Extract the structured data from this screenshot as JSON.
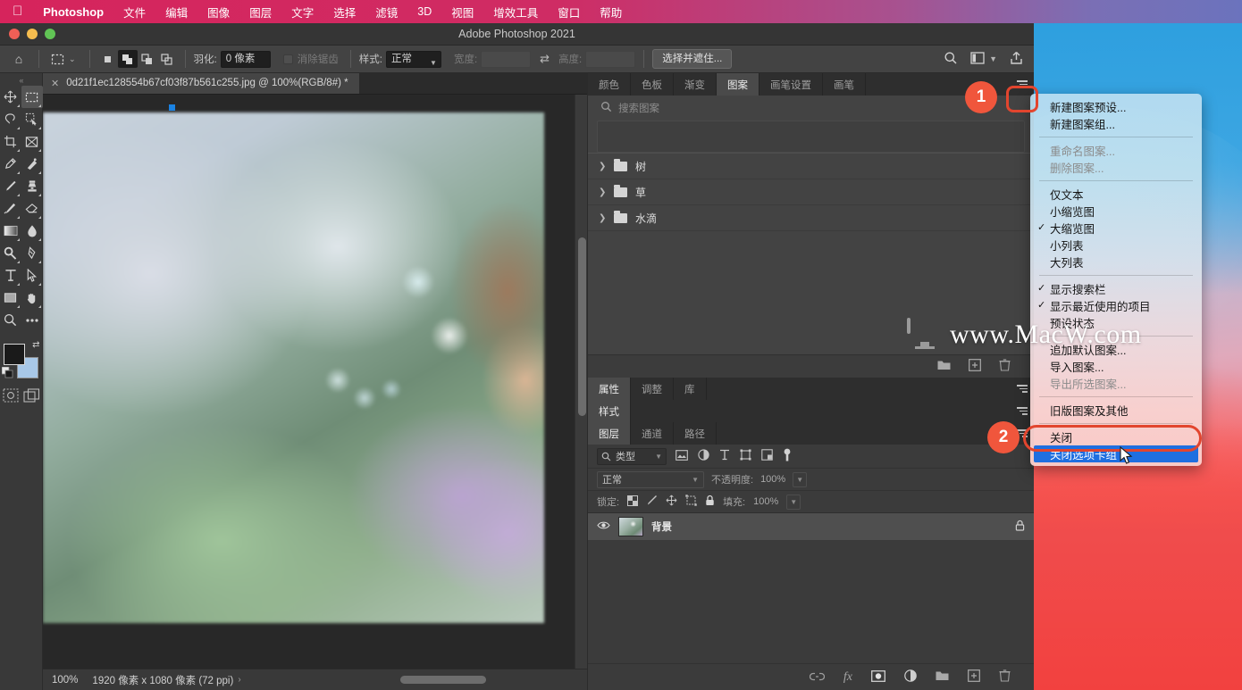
{
  "menubar": {
    "apple_icon": "apple-logo-icon",
    "app_name": "Photoshop",
    "items": [
      "文件",
      "编辑",
      "图像",
      "图层",
      "文字",
      "选择",
      "滤镜",
      "3D",
      "视图",
      "增效工具",
      "窗口",
      "帮助"
    ]
  },
  "window": {
    "title": "Adobe Photoshop 2021"
  },
  "options_bar": {
    "home_icon": "home-icon",
    "tool_icon": "marquee-tool-icon",
    "chevron": "⌄",
    "selection_modes": [
      "new-selection-icon",
      "add-to-selection-icon",
      "subtract-from-selection-icon",
      "intersect-selection-icon"
    ],
    "feather_label": "羽化:",
    "feather_value": "0 像素",
    "antialias_label": "消除锯齿",
    "style_label": "样式:",
    "style_value": "正常",
    "width_label": "宽度:",
    "width_value": "",
    "swap_icon": "swap-arrows-icon",
    "height_label": "高度:",
    "height_value": "",
    "select_mask_button": "选择并遮住...",
    "search_icon": "search-icon",
    "workspace_icon": "workspace-icon",
    "share_icon": "share-icon"
  },
  "document": {
    "tab_close_icon": "close-icon",
    "tab_title": "0d21f1ec128554b67cf03f87b561c255.jpg @ 100%(RGB/8#) *"
  },
  "status_bar": {
    "zoom": "100%",
    "dimensions": "1920 像素 x 1080 像素 (72 ppi)",
    "chevron": "›"
  },
  "toolbox": {
    "grip_icon": "panel-grip-icon",
    "tools": [
      "move-tool-icon",
      "rectangular-marquee-tool-icon",
      "lasso-tool-icon",
      "quick-selection-tool-icon",
      "crop-tool-icon",
      "frame-tool-icon",
      "eyedropper-tool-icon",
      "healing-brush-tool-icon",
      "brush-tool-icon",
      "clone-stamp-tool-icon",
      "history-brush-tool-icon",
      "eraser-tool-icon",
      "gradient-tool-icon",
      "blur-tool-icon",
      "dodge-tool-icon",
      "pen-tool-icon",
      "type-tool-icon",
      "path-selection-tool-icon",
      "rectangle-tool-icon",
      "hand-tool-icon",
      "zoom-tool-icon",
      "more-tools-icon"
    ],
    "foreground_color": "#1a1a1a",
    "background_color": "#a8c8e8",
    "swap_colors_icon": "swap-colors-icon",
    "default_colors_icon": "default-colors-icon",
    "quick_mask_icon": "quick-mask-icon",
    "screen_mode_icon": "screen-mode-icon"
  },
  "panels": {
    "patterns_group": {
      "tabs": [
        "颜色",
        "色板",
        "渐变",
        "图案",
        "画笔设置",
        "画笔"
      ],
      "active_tab": "图案",
      "menu_icon": "panel-menu-icon",
      "search_icon": "search-icon",
      "search_placeholder": "搜索图案",
      "groups": [
        "树",
        "草",
        "水滴"
      ],
      "footer_icons": [
        "new-group-icon",
        "new-pattern-icon",
        "delete-icon"
      ]
    },
    "properties_group": {
      "tabs": [
        "属性",
        "调整",
        "库"
      ],
      "active_tab": "属性",
      "menu_icon": "panel-menu-icon"
    },
    "styles_group": {
      "tabs": [
        "样式"
      ],
      "active_tab": "样式",
      "menu_icon": "panel-menu-icon"
    },
    "layers_group": {
      "tabs": [
        "图层",
        "通道",
        "路径"
      ],
      "active_tab": "图层",
      "menu_icon": "panel-menu-icon"
    }
  },
  "layers": {
    "filter_label": "类型",
    "filter_search_icon": "search-icon",
    "filter_icons": [
      "pixel-filter-icon",
      "adjustment-filter-icon",
      "type-filter-icon",
      "shape-filter-icon",
      "smartobject-filter-icon",
      "filter-toggle-icon"
    ],
    "blend_mode": "正常",
    "opacity_label": "不透明度:",
    "opacity_value": "100%",
    "lock_label": "锁定:",
    "lock_icons": [
      "lock-transparent-icon",
      "lock-image-icon",
      "lock-position-icon",
      "lock-artboard-icon",
      "lock-all-icon"
    ],
    "fill_label": "填充:",
    "fill_value": "100%",
    "rows": [
      {
        "visibility_icon": "eye-icon",
        "name": "背景",
        "lock_icon": "lock-icon"
      }
    ],
    "footer_icons": [
      "link-layers-icon",
      "layer-styles-icon",
      "layer-mask-icon",
      "adjustment-layer-icon",
      "new-group-icon",
      "new-layer-icon",
      "delete-layer-icon"
    ]
  },
  "context_menu": {
    "items": [
      {
        "label": "新建图案预设...",
        "checked": false,
        "disabled": false,
        "selected": false
      },
      {
        "label": "新建图案组...",
        "checked": false,
        "disabled": false,
        "selected": false
      },
      {
        "separator": true
      },
      {
        "label": "重命名图案...",
        "checked": false,
        "disabled": true,
        "selected": false
      },
      {
        "label": "删除图案...",
        "checked": false,
        "disabled": true,
        "selected": false
      },
      {
        "separator": true
      },
      {
        "label": "仅文本",
        "checked": false,
        "disabled": false,
        "selected": false
      },
      {
        "label": "小缩览图",
        "checked": false,
        "disabled": false,
        "selected": false
      },
      {
        "label": "大缩览图",
        "checked": true,
        "disabled": false,
        "selected": false
      },
      {
        "label": "小列表",
        "checked": false,
        "disabled": false,
        "selected": false
      },
      {
        "label": "大列表",
        "checked": false,
        "disabled": false,
        "selected": false
      },
      {
        "separator": true
      },
      {
        "label": "显示搜索栏",
        "checked": true,
        "disabled": false,
        "selected": false
      },
      {
        "label": "显示最近使用的项目",
        "checked": true,
        "disabled": false,
        "selected": false
      },
      {
        "label": "预设状态",
        "checked": false,
        "disabled": false,
        "selected": false
      },
      {
        "separator": true
      },
      {
        "label": "追加默认图案...",
        "checked": false,
        "disabled": false,
        "selected": false
      },
      {
        "label": "导入图案...",
        "checked": false,
        "disabled": false,
        "selected": false
      },
      {
        "label": "导出所选图案...",
        "checked": false,
        "disabled": true,
        "selected": false
      },
      {
        "separator": true
      },
      {
        "label": "旧版图案及其他",
        "checked": false,
        "disabled": false,
        "selected": false
      },
      {
        "separator": true
      },
      {
        "label": "关闭",
        "checked": false,
        "disabled": false,
        "selected": false
      },
      {
        "label": "关闭选项卡组",
        "checked": false,
        "disabled": false,
        "selected": true
      }
    ]
  },
  "annotations": {
    "badge1": "1",
    "badge2": "2",
    "highlight_color": "#e2452e"
  },
  "watermark": {
    "text": "www.MacW.com",
    "icon": "display-monitor-icon"
  }
}
